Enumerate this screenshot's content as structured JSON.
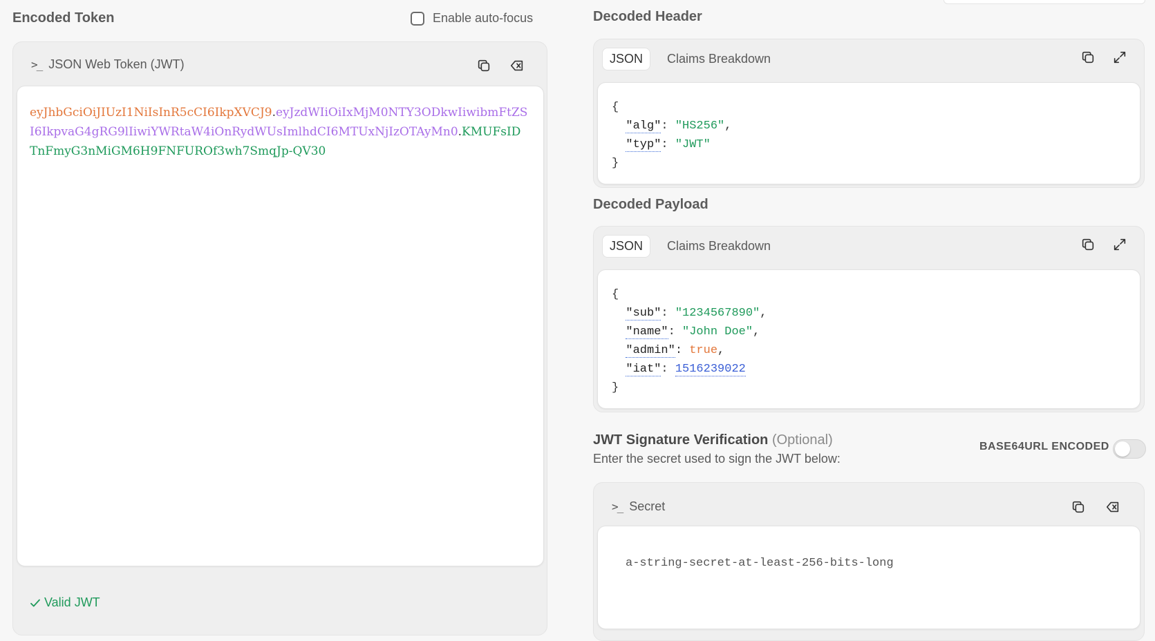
{
  "encoded": {
    "title": "Encoded Token",
    "autofocus_label": "Enable auto-focus",
    "panel_title": "JSON Web Token (JWT)",
    "token": {
      "header": "eyJhbGciOiJIUzI1NiIsInR5cCI6IkpXVCJ9",
      "payload": "eyJzdWIiOiIxMjM0NTY3ODkwIiwibmFtZSI6IkpvaG4gRG9lIiwiYWRtaW4iOnRydWUsImlhdCI6MTUxNjIzOTAyMn0",
      "signature": "KMUFsIDTnFmyG3nMiGM6H9FNFUROf3wh7SmqJp-QV30",
      "dot": "."
    },
    "status": "Valid JWT"
  },
  "decoded_header": {
    "title": "Decoded Header",
    "tabs": [
      "JSON",
      "Claims Breakdown"
    ],
    "alg_key": "\"alg\"",
    "alg_val": "\"HS256\"",
    "typ_key": "\"typ\"",
    "typ_val": "\"JWT\""
  },
  "decoded_payload": {
    "title": "Decoded Payload",
    "tabs": [
      "JSON",
      "Claims Breakdown"
    ],
    "sub_key": "\"sub\"",
    "sub_val": "\"1234567890\"",
    "name_key": "\"name\"",
    "name_val": "\"John Doe\"",
    "admin_key": "\"admin\"",
    "admin_val": "true",
    "iat_key": "\"iat\"",
    "iat_val": "1516239022"
  },
  "signature": {
    "title": "JWT Signature Verification",
    "optional": "(Optional)",
    "subtitle": "Enter the secret used to sign the JWT below:",
    "encoding_label": "BASE64URL ENCODED",
    "encoding_enabled": false,
    "panel_title": "Secret",
    "secret_value": "a-string-secret-at-least-256-bits-long"
  },
  "json_punct": {
    "open": "{",
    "close": "}",
    "colon": ": ",
    "comma": ","
  },
  "icons": {
    "terminal": "terminal-icon",
    "copy": "copy-icon",
    "clear": "clear-icon",
    "expand": "expand-icon",
    "check": "check-icon"
  },
  "colors": {
    "header_segment": "#e3773b",
    "payload_segment": "#a96ee8",
    "signature_segment": "#1f9a5b",
    "valid": "#1f9a5b"
  }
}
